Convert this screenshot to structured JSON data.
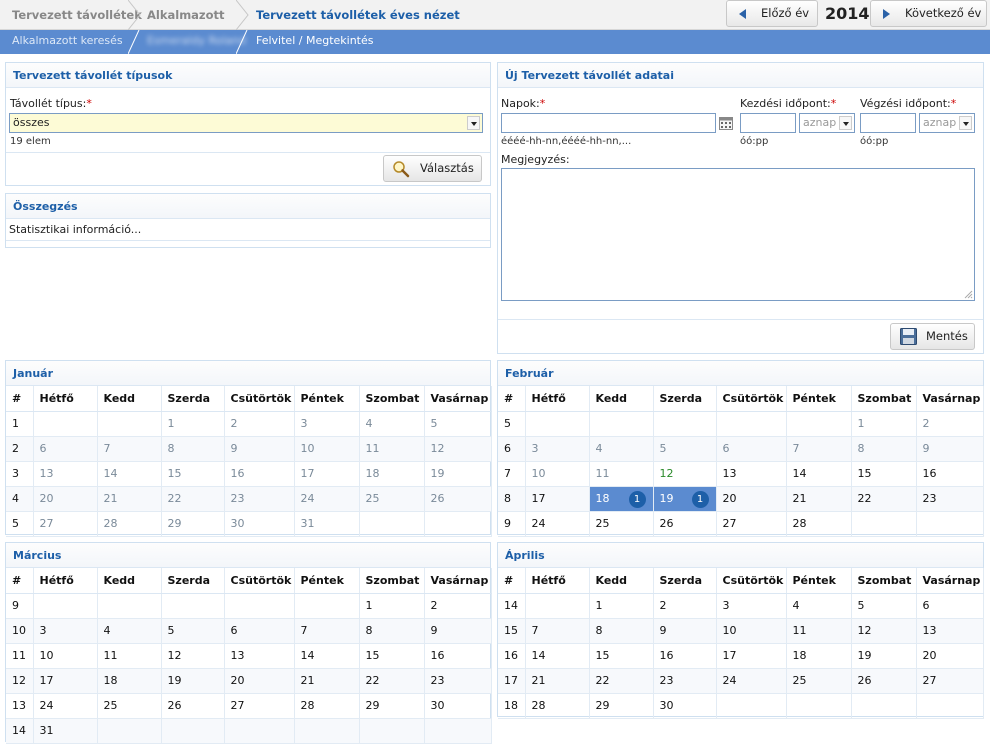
{
  "breadcrumb": {
    "items": [
      "Tervezett távollétek",
      "Alkalmazott",
      "Tervezett távollétek éves nézet"
    ]
  },
  "year_nav": {
    "prev_label": "Előző év",
    "year": "2014",
    "next_label": "Következő év"
  },
  "subnav": {
    "items": [
      "Alkalmazott keresés",
      "Esmeraldy Roland",
      "Felvitel / Megtekintés"
    ]
  },
  "types_panel": {
    "title": "Tervezett távollét típusok",
    "field_label": "Távollét típus:",
    "required_mark": "*",
    "selected_value": "összes",
    "count_text": "19 elem",
    "select_button": "Választás"
  },
  "summary_panel": {
    "title": "Összegzés",
    "content": "Statisztikai információ..."
  },
  "new_absence_panel": {
    "title": "Új Tervezett távollét adatai",
    "days_label": "Napok:",
    "days_hint": "éééé-hh-nn,éééé-hh-nn,...",
    "start_label": "Kezdési időpont:",
    "start_select": "aznap",
    "start_hint": "óó:pp",
    "end_label": "Végzési időpont:",
    "end_select": "aznap",
    "end_hint": "óó:pp",
    "note_label": "Megjegyzés:",
    "save_button": "Mentés"
  },
  "weekday_headers": [
    "#",
    "Hétfő",
    "Kedd",
    "Szerda",
    "Csütörtök",
    "Péntek",
    "Szombat",
    "Vasárnap"
  ],
  "months": [
    {
      "name": "Január",
      "rows": [
        [
          "1",
          "",
          "",
          "1",
          "2",
          "3",
          "4",
          "5"
        ],
        [
          "2",
          "6",
          "7",
          "8",
          "9",
          "10",
          "11",
          "12"
        ],
        [
          "3",
          "13",
          "14",
          "15",
          "16",
          "17",
          "18",
          "19"
        ],
        [
          "4",
          "20",
          "21",
          "22",
          "23",
          "24",
          "25",
          "26"
        ],
        [
          "5",
          "27",
          "28",
          "29",
          "30",
          "31",
          "",
          ""
        ]
      ],
      "dim_all": true
    },
    {
      "name": "Február",
      "rows": [
        [
          "5",
          "",
          "",
          "",
          "",
          "",
          "1",
          "2"
        ],
        [
          "6",
          "3",
          "4",
          "5",
          "6",
          "7",
          "8",
          "9"
        ],
        [
          "7",
          "10",
          "11",
          "12",
          "13",
          "14",
          "15",
          "16"
        ],
        [
          "8",
          "17",
          "18",
          "19",
          "20",
          "21",
          "22",
          "23"
        ],
        [
          "9",
          "24",
          "25",
          "26",
          "27",
          "28",
          "",
          ""
        ]
      ],
      "highlighted": [
        {
          "day": "18",
          "count": "1"
        },
        {
          "day": "19",
          "count": "1"
        }
      ]
    },
    {
      "name": "Március",
      "rows": [
        [
          "9",
          "",
          "",
          "",
          "",
          "",
          "1",
          "2"
        ],
        [
          "10",
          "3",
          "4",
          "5",
          "6",
          "7",
          "8",
          "9"
        ],
        [
          "11",
          "10",
          "11",
          "12",
          "13",
          "14",
          "15",
          "16"
        ],
        [
          "12",
          "17",
          "18",
          "19",
          "20",
          "21",
          "22",
          "23"
        ],
        [
          "13",
          "24",
          "25",
          "26",
          "27",
          "28",
          "29",
          "30"
        ],
        [
          "14",
          "31",
          "",
          "",
          "",
          "",
          "",
          ""
        ]
      ]
    },
    {
      "name": "Április",
      "rows": [
        [
          "14",
          "",
          "1",
          "2",
          "3",
          "4",
          "5",
          "6"
        ],
        [
          "15",
          "7",
          "8",
          "9",
          "10",
          "11",
          "12",
          "13"
        ],
        [
          "16",
          "14",
          "15",
          "16",
          "17",
          "18",
          "19",
          "20"
        ],
        [
          "17",
          "21",
          "22",
          "23",
          "24",
          "25",
          "26",
          "27"
        ],
        [
          "18",
          "28",
          "29",
          "30",
          "",
          "",
          "",
          ""
        ]
      ]
    }
  ],
  "icons": {
    "prev": "triangle-left-icon",
    "next": "triangle-right-icon",
    "select_button": "magnifier-icon",
    "save_button": "floppy-disk-icon",
    "days_picker": "calendar-icon"
  },
  "colors": {
    "accent": "#1d5fa8",
    "subnav_bg": "#5b8bd0",
    "highlight": "#5b8bd0",
    "required": "#cc0000"
  }
}
